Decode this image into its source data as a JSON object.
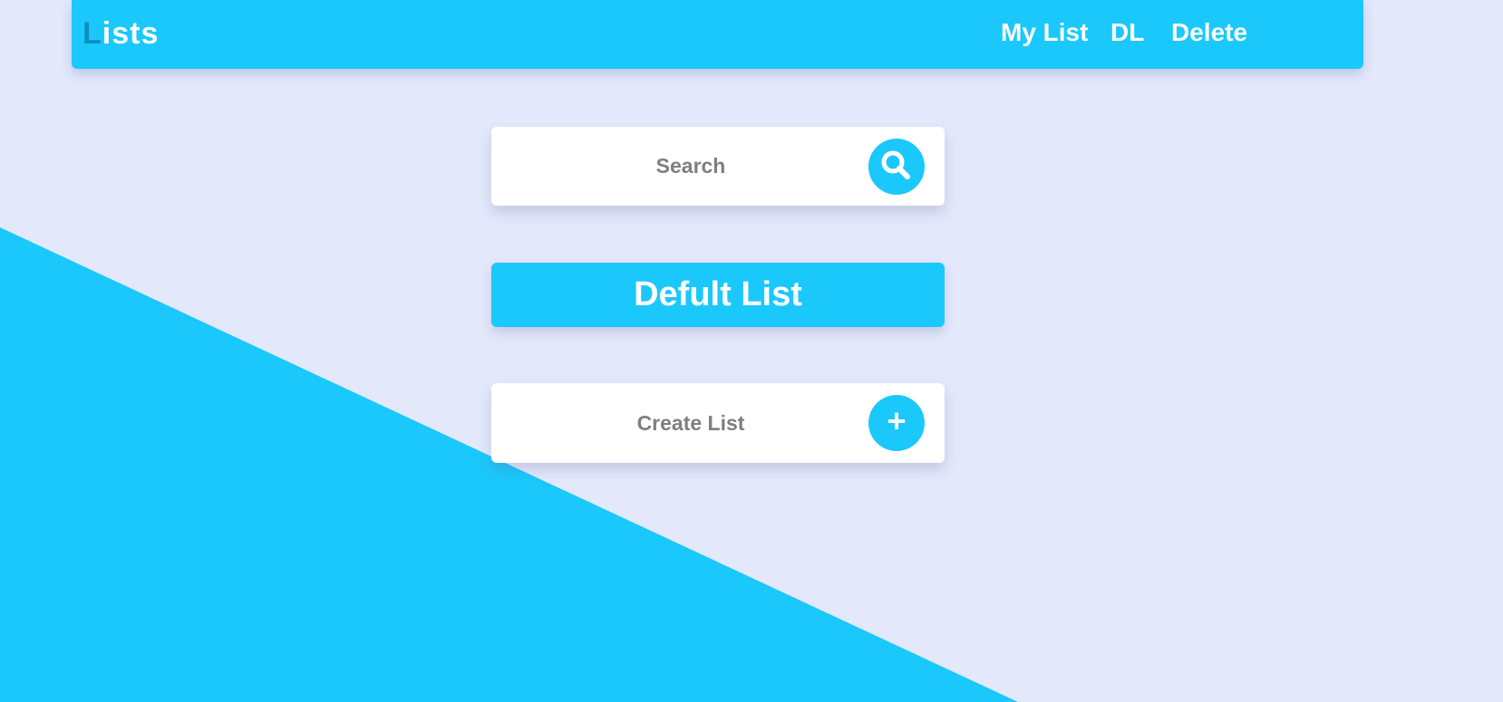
{
  "app": {
    "logo_first_letter": "L",
    "logo_rest": "ists"
  },
  "nav": {
    "items": [
      {
        "label": "My List"
      },
      {
        "label": "DL"
      },
      {
        "label": "Delete"
      }
    ]
  },
  "search": {
    "label": "Search",
    "icon": "search-icon"
  },
  "default_list": {
    "label": "Deful​t List"
  },
  "create_list": {
    "label": "Create List",
    "icon": "plus-icon",
    "icon_glyph": "+"
  },
  "colors": {
    "accent": "#1bc8fb",
    "background": "#e3e8fb",
    "logo_letter": "#0c8fc1",
    "card_text": "#7f7f7f"
  }
}
